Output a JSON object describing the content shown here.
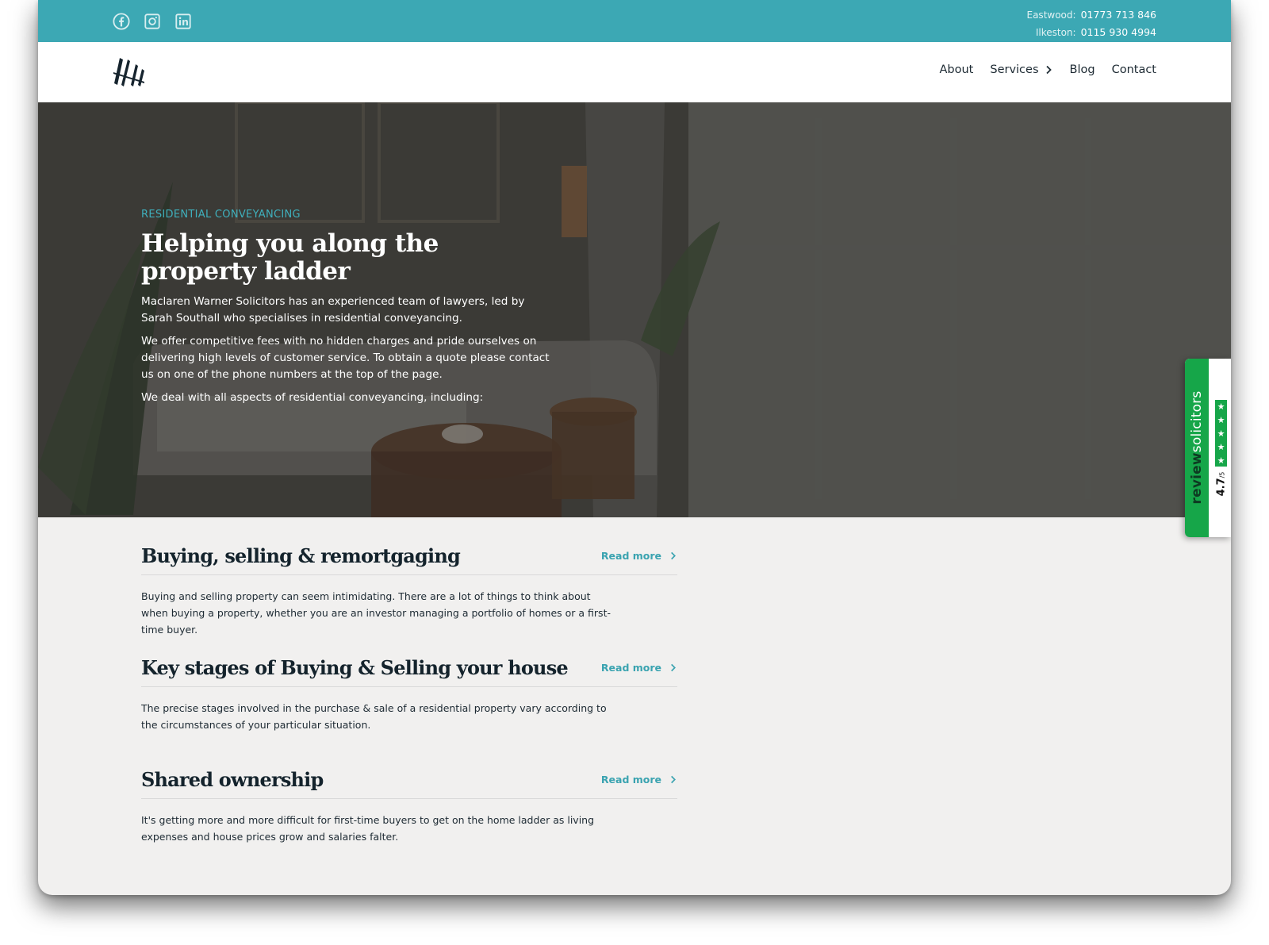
{
  "topbar": {
    "social": [
      "facebook-icon",
      "instagram-icon",
      "linkedin-icon"
    ],
    "phones": [
      {
        "label": "Eastwood:",
        "number": "01773 713 846"
      },
      {
        "label": "Ilkeston:",
        "number": "0115 930 4994"
      }
    ],
    "color": "#3ca8b4"
  },
  "nav": {
    "items": [
      "About",
      "Services",
      "Blog",
      "Contact"
    ]
  },
  "hero": {
    "eyebrow": "RESIDENTIAL CONVEYANCING",
    "title": "Helping you along the property ladder",
    "paragraphs": [
      "Maclaren Warner Solicitors has an experienced team of lawyers, led by Sarah Southall who specialises in residential conveyancing.",
      "We offer competitive fees with no hidden charges and pride ourselves on delivering high levels of customer service. To obtain a quote please contact us on one of the phone numbers at the top of the page.",
      "We deal with all aspects of residential conveyancing, including:"
    ]
  },
  "review_widget": {
    "brand_bold": "review",
    "brand_light": "solicitors",
    "score": "4.7",
    "score_suffix": "/5",
    "color": "#16a649"
  },
  "sections": [
    {
      "title": "Buying, selling & remortgaging",
      "link": "Read more",
      "body": "Buying and selling property can seem intimidating. There are a lot of things to think about when buying a property, whether you are an investor managing a portfolio of homes or a first-time buyer."
    },
    {
      "title": "Key stages of Buying & Selling your house",
      "link": "Read more",
      "body": "The precise stages involved in the purchase & sale of a residential property vary according to the circumstances of your particular situation."
    },
    {
      "title": "Shared ownership",
      "link": "Read more",
      "body": "It's getting more and more difficult for first-time buyers to get on the home ladder as living expenses and house prices grow and salaries falter."
    }
  ],
  "accent": "#3aa3b0"
}
